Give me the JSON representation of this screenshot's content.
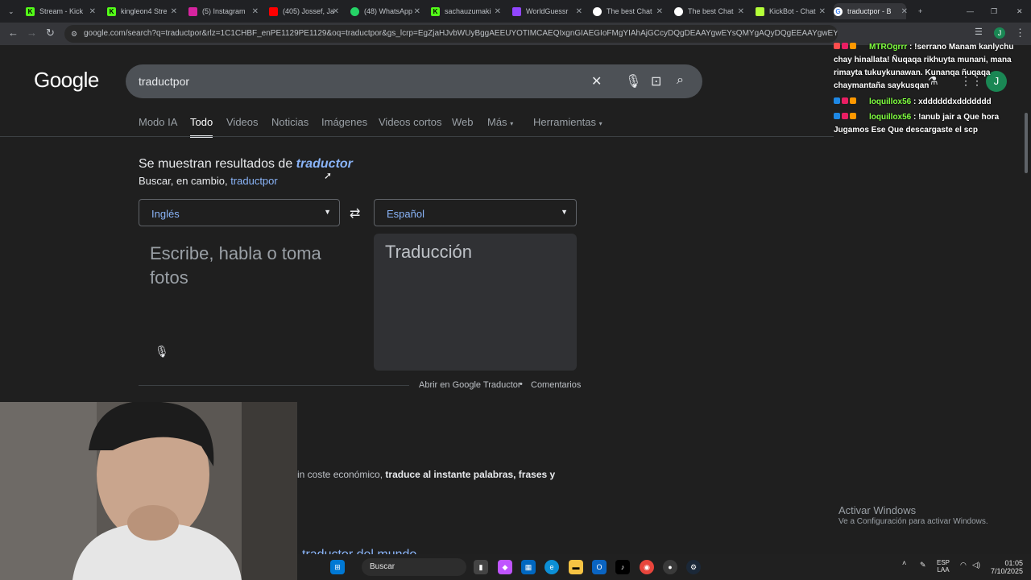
{
  "tabs": [
    {
      "title": "Stream - Kick"
    },
    {
      "title": "kingleon4 Stre"
    },
    {
      "title": "(5) Instagram"
    },
    {
      "title": "(405) Jossef, Ja"
    },
    {
      "title": "(48) WhatsApp"
    },
    {
      "title": "sachauzumaki"
    },
    {
      "title": "WorldGuessr"
    },
    {
      "title": "The best Chat"
    },
    {
      "title": "The best Chat"
    },
    {
      "title": "KickBot - Chat"
    },
    {
      "title": "traductpor - B"
    }
  ],
  "url": "google.com/search?q=traductpor&rlz=1C1CHBF_enPE1129PE1129&oq=traductpor&gs_lcrp=EgZjaHJvbWUyBggAEEUYOTIMCAEQIxgnGIAEGIoFMgYIAhAjGCcyDQgDEAAYgwEYsQMYgAQyDQgEEAAYgwEYsQMYgAQyDQgFEAAYg",
  "google": {
    "logo": "Google",
    "query": "traductpor",
    "nav_tabs": [
      "Modo IA",
      "Todo",
      "Videos",
      "Noticias",
      "Imágenes",
      "Videos cortos",
      "Web",
      "Más",
      "Herramientas"
    ],
    "showing_prefix": "Se muestran resultados de",
    "showing_term": "traductor",
    "instead_prefix": "Buscar, en cambio,",
    "instead_term": "traductpor"
  },
  "translator": {
    "source_lang": "Inglés",
    "target_lang": "Español",
    "source_placeholder": "Escribe, habla o toma fotos",
    "target_placeholder": "Traducción",
    "open_link": "Abrir en Google Traductor",
    "separator": "•",
    "feedback": "Comentarios"
  },
  "result": {
    "desc_start": "in coste económico,",
    "desc_bold": "traduce al instante palabras, frases y",
    "next_title": "traductor del mundo"
  },
  "chat": [
    {
      "user": "MTROgrrr",
      "msg": ": !serrano Manam kanlychu chay hinallata! Ñuqaqa rikhuyta munani, mana rimayta tukuykunawan. Kunanqa ñuqaqa chaymantaña saykusqan"
    },
    {
      "user": "loquillox56",
      "msg": ": xddddddxddddddd"
    },
    {
      "user": "loquillox56",
      "msg": ": !anub jair a Que hora Jugamos Ese Que descargaste el scp"
    }
  ],
  "watermark": {
    "title": "Activar Windows",
    "sub": "Ve a Configuración para activar Windows."
  },
  "taskbar": {
    "search": "Buscar",
    "lang1": "ESP",
    "lang2": "LAA",
    "time": "01:05",
    "date": "7/10/2025"
  }
}
